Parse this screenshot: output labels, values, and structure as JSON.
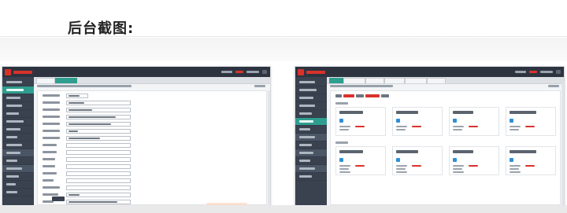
{
  "heading": "后台截图:",
  "brand_colors": {
    "primary_dark": "#2d3440",
    "accent": "#2f9e8f",
    "brand_red": "#d9322b"
  },
  "screenshots": [
    {
      "id_label": "form-screenshot"
    },
    {
      "id_label": "dashboard-screenshot"
    }
  ]
}
